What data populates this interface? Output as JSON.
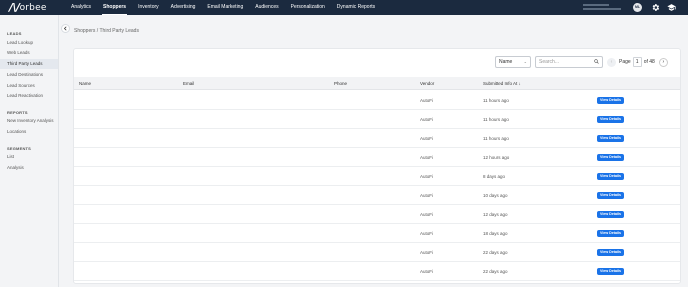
{
  "brand": {
    "logo_text": "orbee"
  },
  "nav": {
    "items": [
      {
        "label": "Analytics",
        "active": false
      },
      {
        "label": "Shoppers",
        "active": true
      },
      {
        "label": "Inventory",
        "active": false
      },
      {
        "label": "Advertising",
        "active": false
      },
      {
        "label": "Email Marketing",
        "active": false
      },
      {
        "label": "Audiences",
        "active": false
      },
      {
        "label": "Personalization",
        "active": false
      },
      {
        "label": "Dynamic Reports",
        "active": false
      }
    ],
    "avatar_initials": "ML",
    "icons": [
      "gear-icon",
      "graduation-cap-icon"
    ]
  },
  "sidebar": {
    "sections": [
      {
        "title": "LEADS",
        "items": [
          {
            "label": "Lead Lookup"
          },
          {
            "label": "Web Leads"
          },
          {
            "label": "Third Party Leads",
            "active": true
          },
          {
            "label": "Lead Destinations"
          },
          {
            "label": "Lead Sources"
          },
          {
            "label": "Lead Reactivation"
          }
        ]
      },
      {
        "title": "REPORTS",
        "items": [
          {
            "label": "New Inventory Analysis"
          },
          {
            "label": "Locations"
          }
        ]
      },
      {
        "title": "SEGMENTS",
        "items": [
          {
            "label": "List"
          },
          {
            "label": "Analysis"
          }
        ]
      }
    ]
  },
  "breadcrumb": {
    "parent": "Shoppers",
    "separator": "/",
    "current": "Third Party Leads"
  },
  "toolbar": {
    "filter_value": "Name",
    "search_placeholder": "Search...",
    "page_label": "Page",
    "page_number": "1",
    "page_total": "of 48"
  },
  "table": {
    "headers": [
      "Name",
      "Email",
      "Phone",
      "Vendor",
      "Submitted Info At"
    ],
    "sort_indicator": "↓",
    "rows": [
      {
        "vendor": "AutoFi",
        "submitted": "11 hours ago",
        "action": "View Details"
      },
      {
        "vendor": "AutoFi",
        "submitted": "11 hours ago",
        "action": "View Details"
      },
      {
        "vendor": "AutoFi",
        "submitted": "11 hours ago",
        "action": "View Details"
      },
      {
        "vendor": "AutoFi",
        "submitted": "12 hours ago",
        "action": "View Details"
      },
      {
        "vendor": "AutoFi",
        "submitted": "8 days ago",
        "action": "View Details"
      },
      {
        "vendor": "AutoFi",
        "submitted": "10 days ago",
        "action": "View Details"
      },
      {
        "vendor": "AutoFi",
        "submitted": "12 days ago",
        "action": "View Details"
      },
      {
        "vendor": "AutoFi",
        "submitted": "18 days ago",
        "action": "View Details"
      },
      {
        "vendor": "AutoFi",
        "submitted": "22 days ago",
        "action": "View Details"
      },
      {
        "vendor": "AutoFi",
        "submitted": "22 days ago",
        "action": "View Details"
      }
    ]
  },
  "colors": {
    "nav_bg": "#1b2a3f",
    "accent": "#1a73e8"
  }
}
